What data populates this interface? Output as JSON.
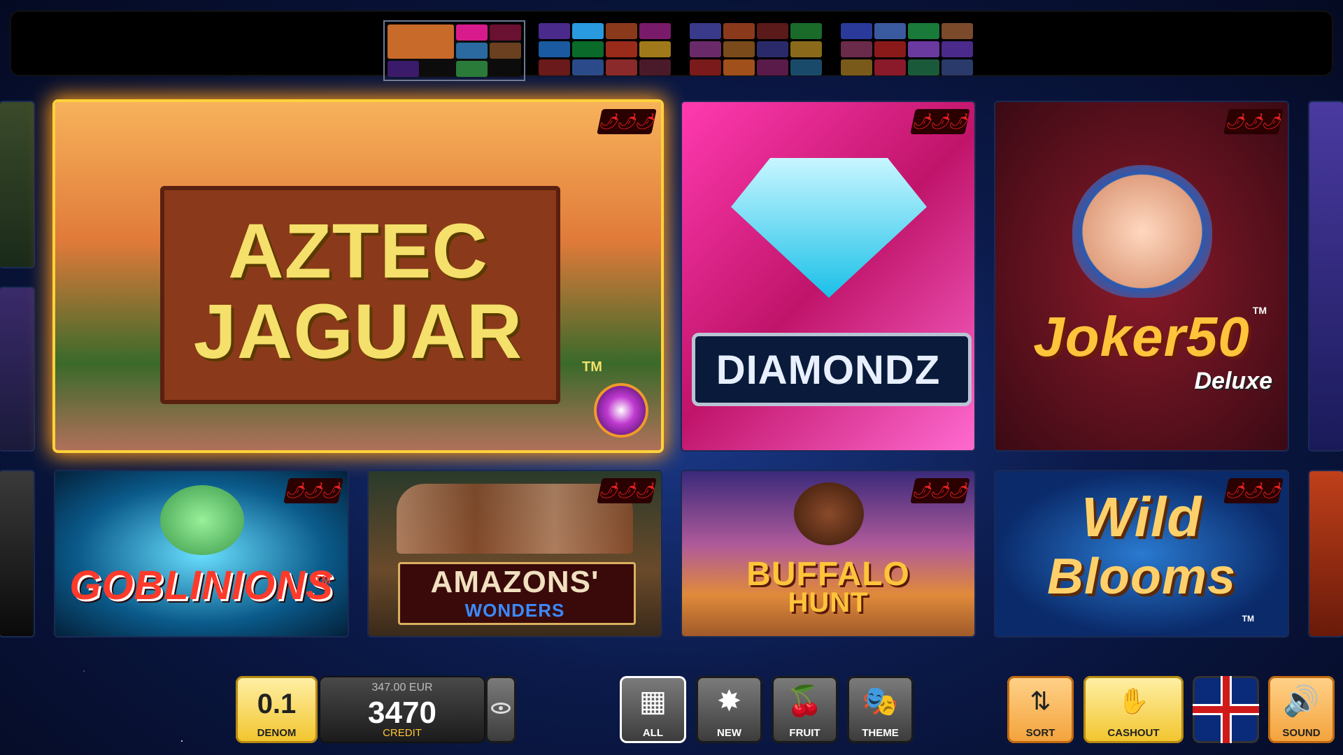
{
  "tiles": {
    "aztec_jaguar": {
      "title_line1": "AZTEC",
      "title_line2": "JAGUAR",
      "tm": "TM"
    },
    "diamondz": {
      "title": "DIAMONDZ",
      "tm": "™"
    },
    "joker50": {
      "title": "Joker50",
      "sub": "Deluxe",
      "tm": "TM"
    },
    "goblinions": {
      "title": "GOBLINIONS",
      "tm": "TM"
    },
    "amazons": {
      "title_line1": "AMAZONS'",
      "title_line2": "WONDERS"
    },
    "buffalo": {
      "title_line1": "BUFFALO",
      "title_line2": "HUNT"
    },
    "wild_blooms": {
      "title_line1": "Wild",
      "title_line2": "Blooms",
      "tm": "TM"
    }
  },
  "chili_icon": "🌶🌶🌶",
  "bottom": {
    "denom_value": "0.1",
    "denom_label": "DENOM",
    "balance_eur": "347.00 EUR",
    "credit_value": "3470",
    "credit_label": "CREDIT",
    "filters": [
      {
        "label": "ALL",
        "icon": "grid-icon"
      },
      {
        "label": "NEW",
        "icon": "star-burst-icon"
      },
      {
        "label": "FRUIT",
        "icon": "cherry-icon"
      },
      {
        "label": "THEME",
        "icon": "mask-icon"
      }
    ],
    "sort_label": "SORT",
    "cashout_label": "CASHOUT",
    "sound_label": "SOUND"
  },
  "colors": {
    "accent_gold": "#ffd23a",
    "panel_grey": "#3a3a3a"
  }
}
